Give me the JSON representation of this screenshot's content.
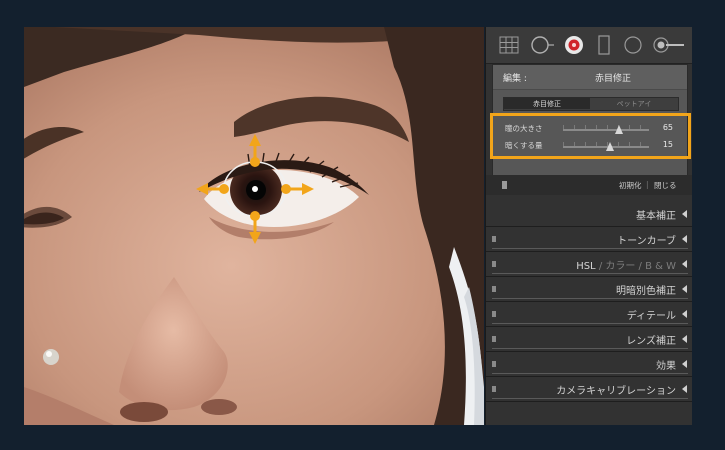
{
  "toolbar": {
    "tools": [
      "crop-grid-icon",
      "spot-removal-icon",
      "red-eye-icon",
      "graduated-filter-icon",
      "radial-filter-icon",
      "adjustment-brush-icon"
    ]
  },
  "red_eye": {
    "header_label": "編集 :",
    "header_value": "赤目修正",
    "modes": [
      "赤目修正",
      "ペットアイ"
    ],
    "pupil_size_label": "瞳の大きさ",
    "pupil_size_value": "65",
    "pupil_size_fraction": 0.65,
    "darken_label": "暗くする量",
    "darken_value": "15",
    "darken_fraction": 0.55,
    "reset_label": "初期化",
    "close_label": "閉じる"
  },
  "sections": {
    "basic": "基本補正",
    "tone_curve": "トーンカーブ",
    "hsl_a": "HSL",
    "hsl_b": " / カラー / B & W",
    "split_toning": "明暗別色補正",
    "detail": "ディテール",
    "lens": "レンズ補正",
    "effects": "効果",
    "camera": "カメラキャリブレーション"
  },
  "colors": {
    "highlight": "#f2a51a",
    "panel": "#323232",
    "background": "#13202e"
  }
}
